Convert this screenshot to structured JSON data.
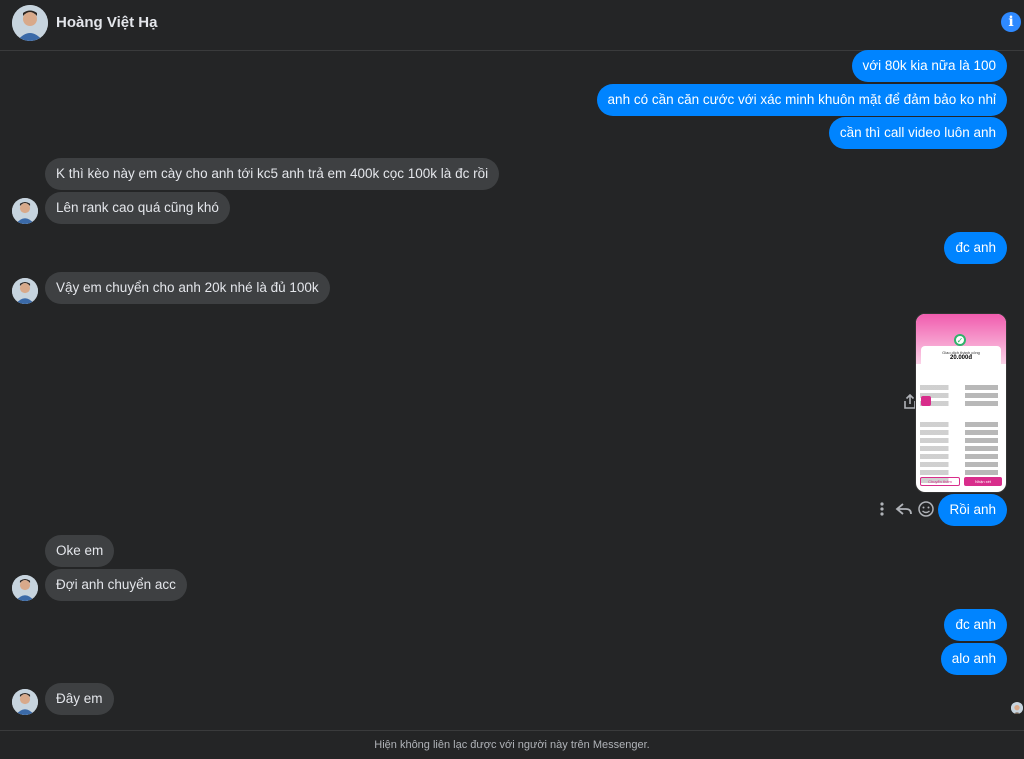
{
  "header": {
    "contact_name": "Hoàng Việt Hạ",
    "info_icon": "info-icon"
  },
  "messages": {
    "m1": "với 80k kia nữa là 100",
    "m2": "anh có cần căn cước với xác minh khuôn mặt để đảm bảo ko nhỉ",
    "m3": "cần thì call video luôn anh",
    "m4": "K thì kèo này em cày cho anh tới kc5 anh trả em 400k cọc 100k là đc rồi",
    "m5": "Lên rank cao quá cũng khó",
    "m6": "đc anh",
    "m7": "Vậy em chuyển cho anh 20k nhé là đủ 100k",
    "m8": "Rồi anh",
    "m9": "Oke em",
    "m10": "Đợi anh chuyển acc",
    "m11": "đc anh",
    "m12": "alo anh",
    "m13": "Đây em"
  },
  "image_message": {
    "amount": "20.000đ",
    "amount_label": "Giao dịch thành công",
    "button_left": "Chuyển thêm",
    "button_right": "Nhận xét"
  },
  "footer": {
    "notice": "Hiện không liên lạc được với người này trên Messenger."
  },
  "colors": {
    "outgoing": "#0084ff",
    "incoming": "#3e4042",
    "background": "#242526"
  }
}
